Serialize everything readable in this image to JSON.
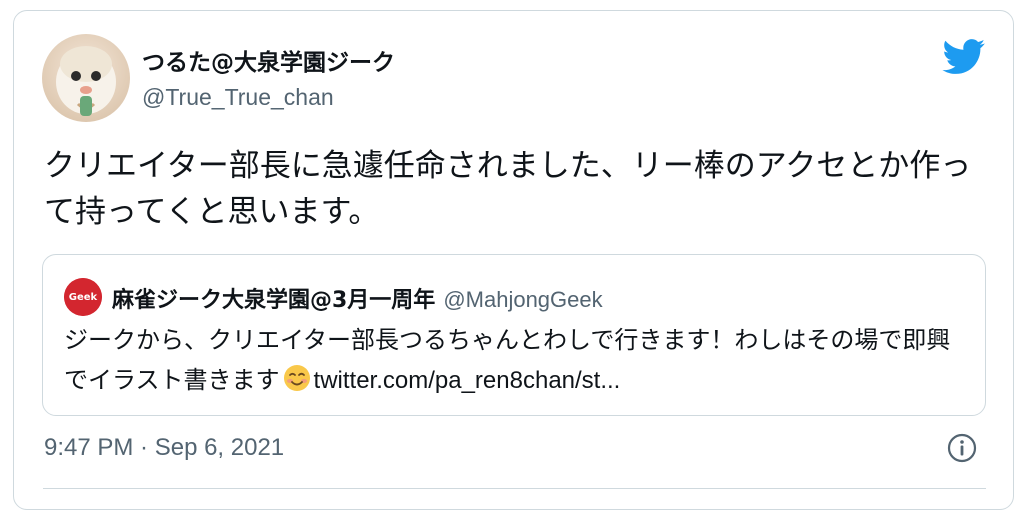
{
  "tweet": {
    "display_name": "つるた@大泉学園ジーク",
    "handle": "@True_True_chan",
    "text": "クリエイター部長に急遽任命されました、リー棒のアクセとか作って持ってくと思います。",
    "timestamp": "9:47 PM · Sep 6, 2021"
  },
  "quote": {
    "avatar_text": "Geek",
    "display_name": "麻雀ジーク大泉学園@3月一周年",
    "handle": "@MahjongGeek",
    "text": "ジークから、クリエイター部長つるちゃんとわしで行きます！わしはその場で即興でイラスト書きます",
    "link": "twitter.com/pa_ren8chan/st..."
  },
  "icons": {
    "brand": "twitter-bird-icon",
    "info": "info-icon",
    "emoji": "smiling-face-icon"
  },
  "colors": {
    "twitter_blue": "#1d9bf0",
    "secondary_text": "#536471",
    "border": "#cfd9de",
    "quote_avatar_red": "#d3262f"
  }
}
